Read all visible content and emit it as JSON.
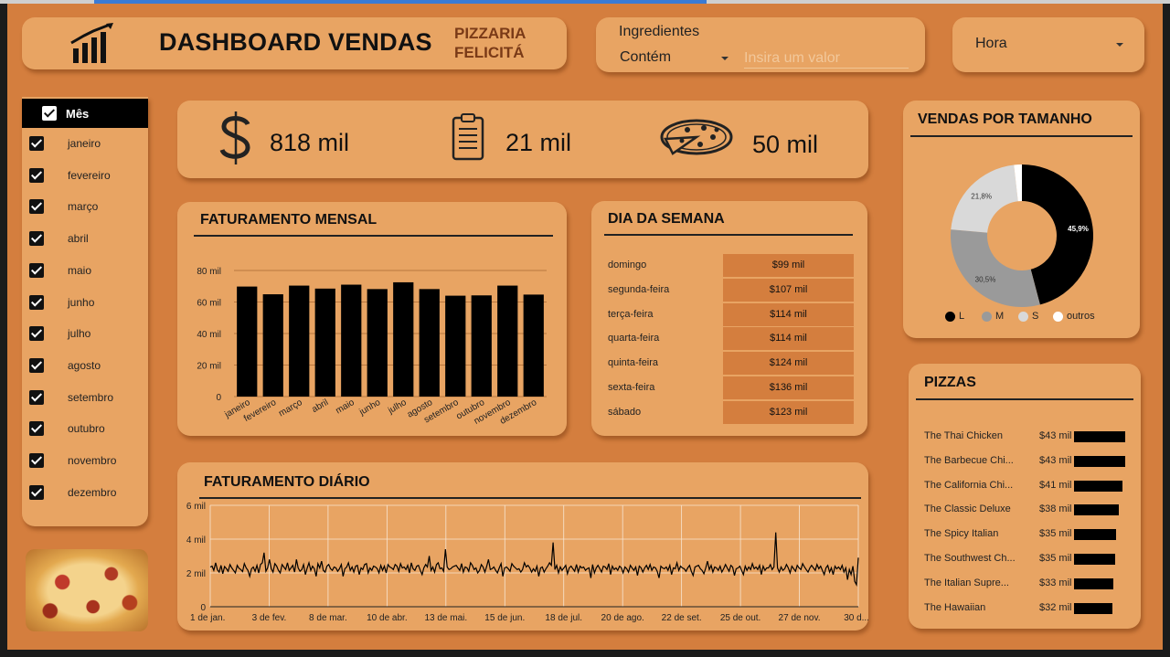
{
  "header": {
    "title": "DASHBOARD VENDAS",
    "brand_line1": "PIZZARIA",
    "brand_line2": "FELICITÁ",
    "icon": "bar-chart-growth-icon"
  },
  "filters": {
    "ingredients": {
      "label": "Ingredientes",
      "operator": "Contém",
      "placeholder": "Insira um valor"
    },
    "hour": {
      "value": "Hora"
    }
  },
  "slicer": {
    "header": "Mês",
    "items": [
      "janeiro",
      "fevereiro",
      "março",
      "abril",
      "maio",
      "junho",
      "julho",
      "agosto",
      "setembro",
      "outubro",
      "novembro",
      "dezembro"
    ]
  },
  "kpis": [
    {
      "icon": "dollar-icon",
      "value": "818 mil"
    },
    {
      "icon": "clipboard-icon",
      "value": "21 mil"
    },
    {
      "icon": "pizza-icon",
      "value": "50 mil"
    }
  ],
  "monthly": {
    "title": "FATURAMENTO MENSAL"
  },
  "weekday": {
    "title": "DIA DA SEMANA"
  },
  "daily": {
    "title": "FATURAMENTO DIÁRIO"
  },
  "size": {
    "title": "VENDAS POR TAMANHO"
  },
  "pizzas": {
    "title": "PIZZAS",
    "items": [
      {
        "name": "The Thai Chicken",
        "value": "$43 mil",
        "amount": 43
      },
      {
        "name": "The Barbecue Chi...",
        "value": "$43 mil",
        "amount": 42.8
      },
      {
        "name": "The California Chi...",
        "value": "$41 mil",
        "amount": 41
      },
      {
        "name": "The Classic Deluxe",
        "value": "$38 mil",
        "amount": 38
      },
      {
        "name": "The Spicy Italian",
        "value": "$35 mil",
        "amount": 35
      },
      {
        "name": "The Southwest Ch...",
        "value": "$35 mil",
        "amount": 34.8
      },
      {
        "name": "The Italian Supre...",
        "value": "$33 mil",
        "amount": 33
      },
      {
        "name": "The Hawaiian",
        "value": "$32 mil",
        "amount": 32
      }
    ]
  },
  "colors": {
    "background": "#d47e3e",
    "card": "#e8a463",
    "accent": "#000000",
    "brand": "#7a3a17"
  },
  "chart_data": [
    {
      "type": "bar",
      "title": "FATURAMENTO MENSAL",
      "categories": [
        "janeiro",
        "fevereiro",
        "março",
        "abril",
        "maio",
        "junho",
        "julho",
        "agosto",
        "setembro",
        "outubro",
        "novembro",
        "dezembro"
      ],
      "values": [
        69800,
        64900,
        70400,
        68500,
        71000,
        68200,
        72500,
        68200,
        64000,
        64200,
        70400,
        64700
      ],
      "yticks": [
        "0",
        "20 mil",
        "40 mil",
        "60 mil",
        "80 mil"
      ],
      "ylim": [
        0,
        80000
      ]
    },
    {
      "type": "table",
      "title": "DIA DA SEMANA",
      "rows": [
        {
          "day": "domingo",
          "value": "$99 mil"
        },
        {
          "day": "segunda-feira",
          "value": "$107 mil"
        },
        {
          "day": "terça-feira",
          "value": "$114 mil"
        },
        {
          "day": "quarta-feira",
          "value": "$114 mil"
        },
        {
          "day": "quinta-feira",
          "value": "$124 mil"
        },
        {
          "day": "sexta-feira",
          "value": "$136 mil"
        },
        {
          "day": "sábado",
          "value": "$123 mil"
        }
      ]
    },
    {
      "type": "pie",
      "title": "VENDAS POR TAMANHO",
      "slices": [
        {
          "label": "L",
          "value": 45.9,
          "display": "45,9%",
          "color": "#000000"
        },
        {
          "label": "M",
          "value": 30.5,
          "display": "30,5%",
          "color": "#9a9a9a"
        },
        {
          "label": "S",
          "value": 21.8,
          "display": "21,8%",
          "color": "#d9d9d9"
        },
        {
          "label": "outros",
          "value": 1.8,
          "display": "",
          "color": "#ffffff"
        }
      ]
    },
    {
      "type": "line",
      "title": "FATURAMENTO DIÁRIO",
      "yticks": [
        "0",
        "2 mil",
        "4 mil",
        "6 mil"
      ],
      "ylim": [
        0,
        6000
      ],
      "xticks": [
        "1 de jan.",
        "3 de fev.",
        "8 de mar.",
        "10 de abr.",
        "13 de mai.",
        "15 de jun.",
        "18 de jul.",
        "20 de ago.",
        "22 de set.",
        "25 de out.",
        "27 de nov.",
        "30 d..."
      ],
      "series": [
        {
          "values": [
            2350,
            2400,
            2150,
            2600,
            2180,
            2050,
            2450,
            1950,
            2380,
            2250,
            2100,
            2500,
            2300,
            2150,
            2000,
            2450,
            2280,
            2200,
            2080,
            2550,
            2300,
            2150,
            1800,
            2250,
            2350,
            2100,
            2450,
            2000,
            2500,
            2600,
            3200,
            2100,
            2300,
            2800,
            2250,
            2050,
            2550,
            2400,
            2150,
            2000,
            2500,
            2350,
            2200,
            2600,
            2150,
            2300,
            2450,
            2050,
            2800,
            2300,
            2100,
            2200,
            2500,
            1900,
            2300,
            2600,
            2150,
            2400,
            2250,
            1800,
            2550,
            2300,
            2700,
            2150,
            2050,
            2400,
            2500,
            2250,
            2150,
            2350,
            2300,
            2100,
            2250,
            2500,
            1800,
            2250,
            2350,
            2600,
            2150,
            2350,
            2050,
            2400,
            2450,
            1900,
            2300,
            2200,
            2500,
            2550,
            2000,
            2300,
            2150,
            2400,
            2350,
            2250,
            2000,
            2450,
            2150,
            2400,
            2000,
            2500,
            2350,
            2300,
            2200,
            2500,
            2400,
            2100,
            2550,
            2300,
            2350,
            2200,
            2450,
            2000,
            2600,
            2250,
            2150,
            2400,
            2450,
            2150,
            1900,
            2300,
            2500,
            2350,
            3000,
            2150,
            2350,
            2050,
            2500,
            2600,
            2250,
            2300,
            2100,
            3400,
            2350,
            2200,
            2250,
            2350,
            2400,
            2450,
            2300,
            2150,
            2550,
            2050,
            2350,
            2300,
            2100,
            2600,
            2450,
            2200,
            2300,
            2000,
            2150,
            2500,
            2350,
            2050,
            2400,
            2800,
            2200,
            2250,
            2350,
            2150,
            2000,
            2300,
            2550,
            1800,
            2300,
            2350,
            2250,
            2100,
            2550,
            2400,
            2300,
            2200,
            2250,
            2050,
            2200,
            2600,
            2350,
            2450,
            2300,
            2050,
            2250,
            2100,
            2400,
            1800,
            2300,
            2350,
            2050,
            2250,
            2400,
            2600,
            2450,
            3800,
            2200,
            2450,
            2000,
            2350,
            2150,
            2300,
            2450,
            1950,
            2300,
            2400,
            2250,
            2100,
            2500,
            2050,
            2400,
            2300,
            2350,
            2150,
            2250,
            2300,
            1700,
            2500,
            2000,
            2300,
            2450,
            2250,
            2050,
            2400,
            2350,
            2200,
            2550,
            1900,
            2400,
            2200,
            2300,
            2150,
            2400,
            2300,
            2000,
            2350,
            2250,
            2050,
            2450,
            2300,
            2150,
            2350,
            1850,
            2400,
            2300,
            2050,
            2300,
            2450,
            2200,
            2500,
            2150,
            2350,
            2300,
            2100,
            1700,
            2400,
            2300,
            2250,
            2350,
            2150,
            2450,
            1900,
            2300,
            2250,
            2600,
            2150,
            2400,
            2300,
            2250,
            2100,
            2300,
            2450,
            2100,
            1850,
            2350,
            2400,
            2450,
            2250,
            2150,
            1950,
            2300,
            2700,
            2200,
            2450,
            2050,
            2350,
            2300,
            2150,
            2400,
            2050,
            2250,
            2500,
            2300,
            2100,
            2450,
            2350,
            1850,
            2250,
            2300,
            2400,
            2150,
            1900,
            2400,
            2150,
            2350,
            2200,
            2550,
            2250,
            2350,
            2200,
            2450,
            1900,
            2400,
            2150,
            2300,
            2300,
            2500,
            2200,
            2350,
            4400,
            2300,
            2050,
            2350,
            2150,
            2250,
            2500,
            2300,
            2000,
            2400,
            2250,
            2100,
            2450,
            2300,
            2200,
            2550,
            2350,
            2200,
            2050,
            2300,
            2450,
            2300,
            2150,
            2500,
            2250,
            2400,
            2150,
            1900,
            2300,
            2450,
            2050,
            2300,
            1900,
            2400,
            2250,
            2350,
            2200,
            2450,
            2050,
            2300,
            1600,
            2200,
            1900,
            2400,
            1500,
            1300,
            2900
          ]
        }
      ]
    }
  ]
}
